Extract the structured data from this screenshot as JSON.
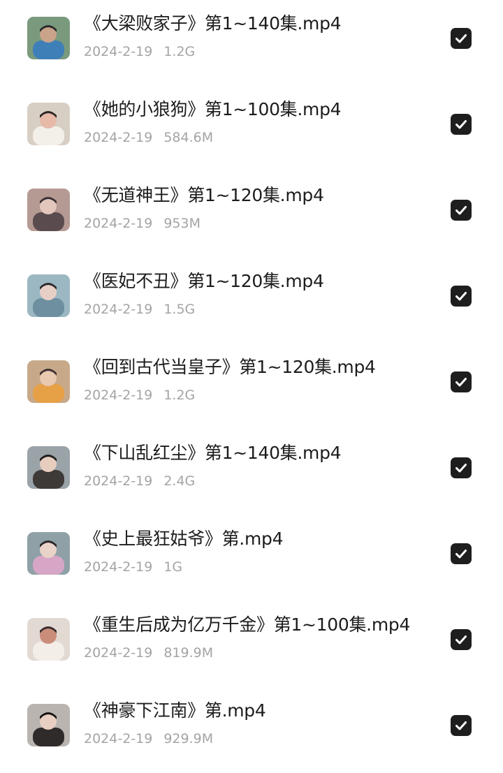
{
  "files": [
    {
      "name": "《大梁败家子》第1~140集.mp4",
      "date": "2024-2-19",
      "size": "1.2G",
      "checked": true,
      "thumb_colors": [
        "#7a9a7e",
        "#3f7fb8",
        "#c9a48a",
        "#2a2a2a"
      ]
    },
    {
      "name": "《她的小狼狗》第1~100集.mp4",
      "date": "2024-2-19",
      "size": "584.6M",
      "checked": true,
      "thumb_colors": [
        "#d8cfc4",
        "#f3efe9",
        "#e6b9a8",
        "#2c2623"
      ]
    },
    {
      "name": "《无道神王》第1~120集.mp4",
      "date": "2024-2-19",
      "size": "953M",
      "checked": true,
      "thumb_colors": [
        "#b59a93",
        "#5a4b4f",
        "#e3c7bd",
        "#3a3135"
      ]
    },
    {
      "name": "《医妃不丑》第1~120集.mp4",
      "date": "2024-2-19",
      "size": "1.5G",
      "checked": true,
      "thumb_colors": [
        "#9bb8c2",
        "#6d8fa0",
        "#e8cfc6",
        "#2e2a2c"
      ]
    },
    {
      "name": "《回到古代当皇子》第1~120集.mp4",
      "date": "2024-2-19",
      "size": "1.2G",
      "checked": true,
      "thumb_colors": [
        "#c7a98a",
        "#e6a046",
        "#e9c8b0",
        "#3b3030"
      ]
    },
    {
      "name": "《下山乱红尘》第1~140集.mp4",
      "date": "2024-2-19",
      "size": "2.4G",
      "checked": true,
      "thumb_colors": [
        "#9aa3a8",
        "#3e3a38",
        "#e7cdbd",
        "#1f1d1d"
      ]
    },
    {
      "name": "《史上最狂姑爷》第.mp4",
      "date": "2024-2-19",
      "size": "1G",
      "checked": true,
      "thumb_colors": [
        "#8fa1a6",
        "#d7a6c6",
        "#e9d3c8",
        "#2a2629"
      ]
    },
    {
      "name": "《重生后成为亿万千金》第1~100集.mp4",
      "date": "2024-2-19",
      "size": "819.9M",
      "checked": true,
      "thumb_colors": [
        "#e2d9d3",
        "#f4eee9",
        "#c98d7a",
        "#3a2e2c"
      ]
    },
    {
      "name": "《神豪下江南》第.mp4",
      "date": "2024-2-19",
      "size": "929.9M",
      "checked": true,
      "thumb_colors": [
        "#b9b4b0",
        "#2f2b2a",
        "#e8cfc2",
        "#141212"
      ]
    }
  ],
  "icons": {
    "thumbnail": "video-thumbnail",
    "checkbox": "check-icon"
  },
  "colors": {
    "title_text": "#1c1c1c",
    "meta_text": "#a4a4a4",
    "checkbox_fill": "#1e1e1e",
    "check_mark": "#ffffff",
    "background": "#ffffff"
  }
}
